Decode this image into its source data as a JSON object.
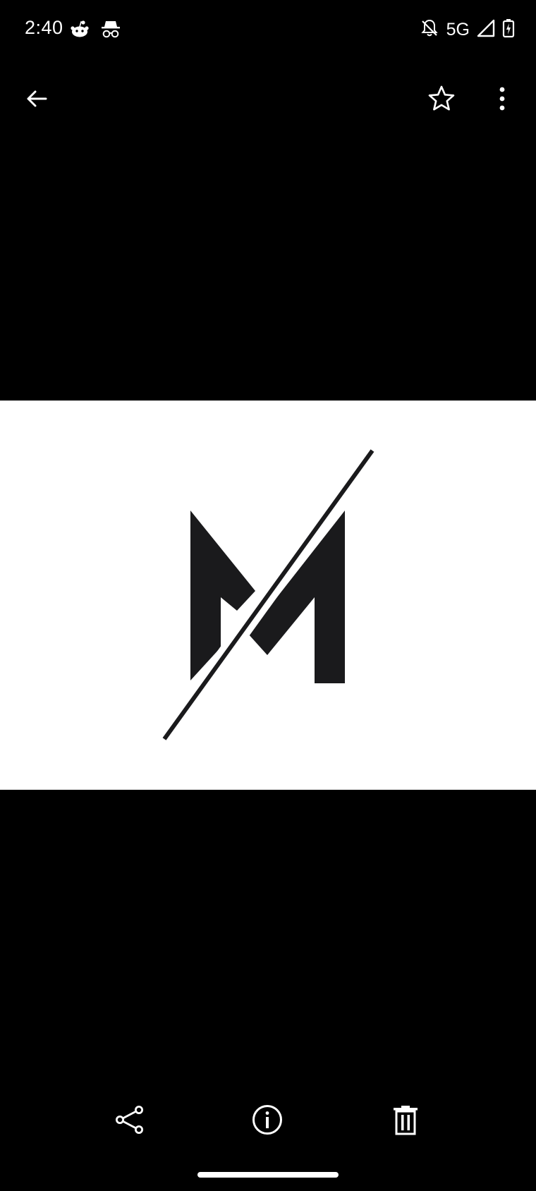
{
  "status_bar": {
    "time": "2:40",
    "left_icons": [
      "reddit-icon",
      "incognito-icon"
    ],
    "network": "5G",
    "right_icons": [
      "notifications-off-icon",
      "signal-icon",
      "battery-charging-icon"
    ]
  },
  "top_bar": {
    "actions": [
      "back-arrow-icon",
      "star-icon",
      "more-vert-icon"
    ]
  },
  "photo": {
    "content": "m-logo-image",
    "background": "#ffffff",
    "mark_color": "#1a1a1c"
  },
  "bottom_bar": {
    "actions": [
      "share-icon",
      "info-icon",
      "delete-icon"
    ]
  },
  "colors": {
    "background": "#000000",
    "icon": "#ffffff"
  }
}
